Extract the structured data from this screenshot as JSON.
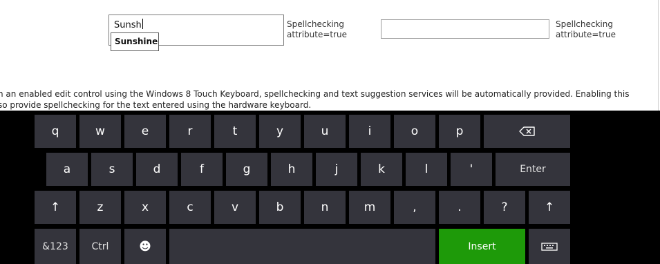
{
  "form": {
    "field1": {
      "value": "Sunsh",
      "suggestion": "Sunshine",
      "label_line1": "Spellchecking",
      "label_line2": "attribute=true"
    },
    "field2": {
      "value": "",
      "label_line1": "Spellchecking",
      "label_line2": "attribute=true"
    }
  },
  "description": {
    "line1": "n an enabled edit control using the Windows 8 Touch Keyboard, spellchecking and text suggestion services will be automatically provided. Enabling this",
    "line2": "so provide spellchecking for the text entered using the hardware keyboard."
  },
  "keyboard": {
    "row1": [
      "q",
      "w",
      "e",
      "r",
      "t",
      "y",
      "u",
      "i",
      "o",
      "p"
    ],
    "row2": [
      "a",
      "s",
      "d",
      "f",
      "g",
      "h",
      "j",
      "k",
      "l",
      "'"
    ],
    "enter_label": "Enter",
    "row3": [
      "z",
      "x",
      "c",
      "v",
      "b",
      "n",
      "m",
      ",",
      ".",
      "?"
    ],
    "shift_glyph": "↑",
    "symbols_label": "&123",
    "ctrl_label": "Ctrl",
    "emoji_glyph": "☻",
    "insert_label": "Insert",
    "icons": {
      "backspace": "backspace-icon",
      "keyboard": "keyboard-icon",
      "shift": "shift-arrow-icon",
      "emoji": "emoji-icon"
    },
    "colors": {
      "background": "#000000",
      "key": "#34343c",
      "insert": "#1e9a09",
      "text": "#ffffff"
    }
  }
}
